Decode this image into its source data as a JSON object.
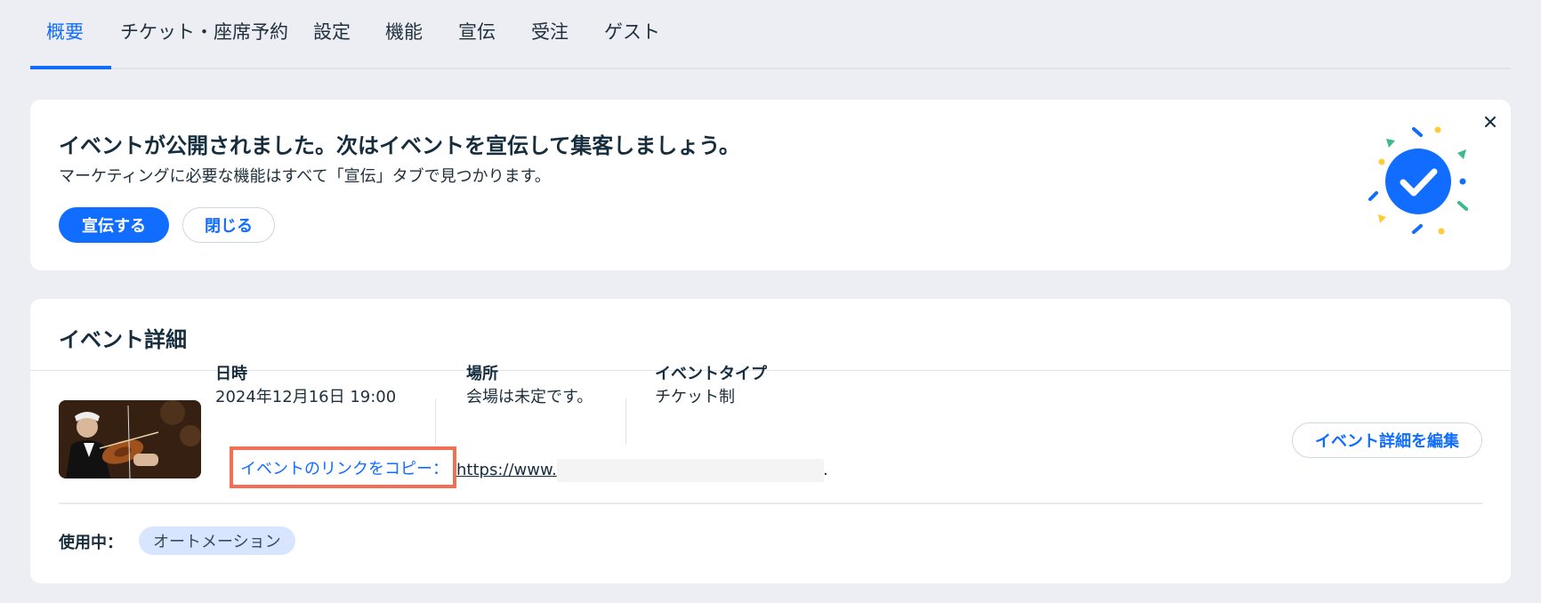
{
  "tabs": [
    {
      "label": "概要",
      "active": true
    },
    {
      "label": "チケット・座席予約"
    },
    {
      "label": "設定"
    },
    {
      "label": "機能"
    },
    {
      "label": "宣伝"
    },
    {
      "label": "受注"
    },
    {
      "label": "ゲスト"
    }
  ],
  "banner": {
    "title": "イベントが公開されました。次はイベントを宣伝して集客しましょう。",
    "description": "マーケティングに必要な機能はすべて「宣伝」タブで見つかります。",
    "primary_button": "宣伝する",
    "secondary_button": "閉じる",
    "close_icon": "close-icon",
    "illustration": "checkmark-celebration"
  },
  "details": {
    "title": "イベント詳細",
    "date_label": "日時",
    "date_value": "2024年12月16日 19:00",
    "location_label": "場所",
    "location_value": "会場は未定です。",
    "type_label": "イベントタイプ",
    "type_value": "チケット制",
    "copy_link_label": "イベントのリンクをコピー：",
    "url_prefix": "https://www.",
    "url_suffix": ".",
    "edit_button": "イベント詳細を編集",
    "in_use_label": "使用中：",
    "in_use_tag": "オートメーション"
  },
  "colors": {
    "accent": "#116dff",
    "highlight_box": "#f06f55",
    "background": "#eceef3",
    "tag_bg": "#d7e6fe"
  }
}
